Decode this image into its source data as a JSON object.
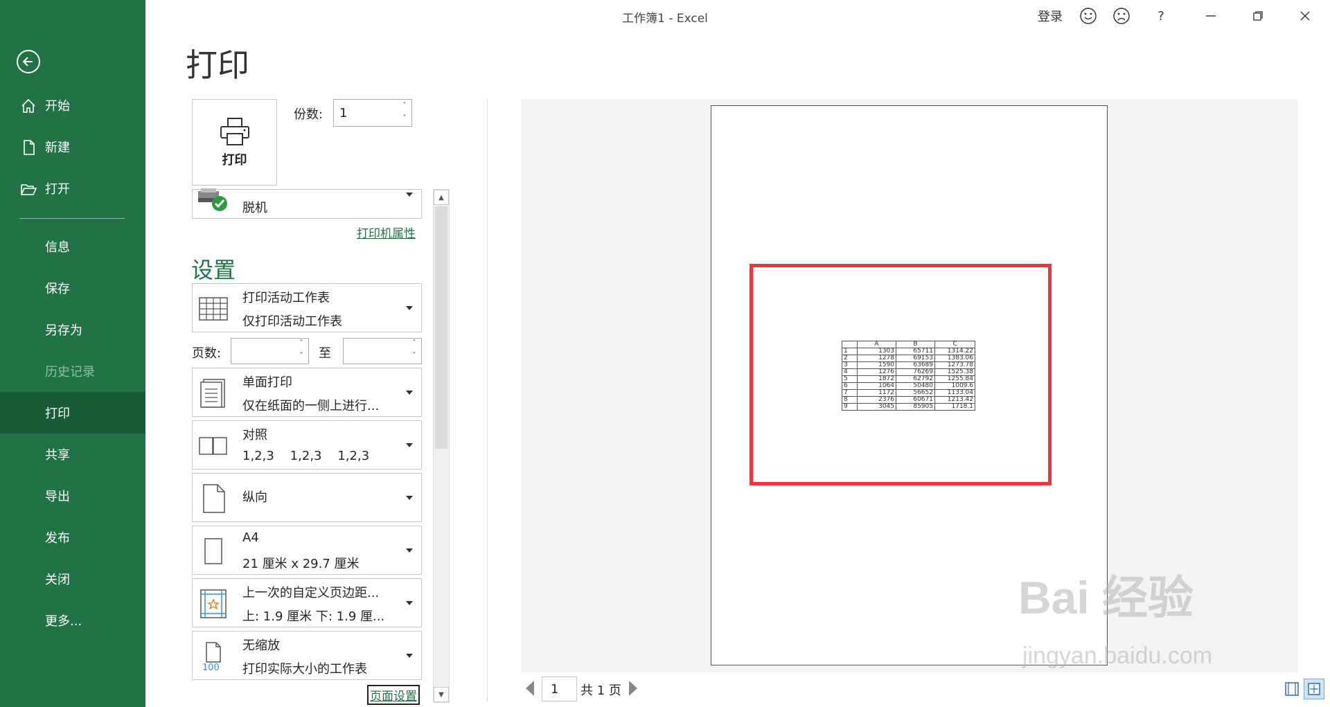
{
  "window": {
    "title": "工作簿1  -  Excel",
    "signin": "登录",
    "help": "?"
  },
  "sidebar": {
    "items": [
      {
        "label": "开始"
      },
      {
        "label": "新建"
      },
      {
        "label": "打开"
      },
      {
        "label": "信息"
      },
      {
        "label": "保存"
      },
      {
        "label": "另存为"
      },
      {
        "label": "历史记录"
      },
      {
        "label": "打印"
      },
      {
        "label": "共享"
      },
      {
        "label": "导出"
      },
      {
        "label": "发布"
      },
      {
        "label": "关闭"
      },
      {
        "label": "更多..."
      }
    ],
    "active": "打印"
  },
  "print": {
    "title": "打印",
    "print_button": "打印",
    "copies_label": "份数:",
    "copies_value": "1",
    "printer_name": "脱机",
    "printer_properties": "打印机属性",
    "settings_heading": "设置",
    "pages_label": "页数:",
    "pages_to": "至",
    "options": [
      {
        "line1": "打印活动工作表",
        "line2": "仅打印活动工作表"
      },
      {
        "line1": "单面打印",
        "line2": "仅在纸面的一侧上进行..."
      },
      {
        "line1": "对照",
        "line2": "1,2,3    1,2,3    1,2,3"
      },
      {
        "line1": "纵向"
      },
      {
        "line1": "A4",
        "line2": "21 厘米 x 29.7 厘米"
      },
      {
        "line1": "上一次的自定义页边距...",
        "line2": "上: 1.9 厘米 下: 1.9 厘..."
      },
      {
        "line1": "无缩放",
        "line2": "打印实际大小的工作表"
      }
    ],
    "scale_icon_text": "100",
    "page_setup": "页面设置"
  },
  "preview": {
    "current_page": "1",
    "total_pages": "共 1 页",
    "table": {
      "headers": [
        "A",
        "B",
        "C"
      ],
      "rows": [
        [
          "1",
          "1303",
          "65711",
          "1314.22"
        ],
        [
          "2",
          "1278",
          "69153",
          "1383.06"
        ],
        [
          "3",
          "1590",
          "63689",
          "1273.78"
        ],
        [
          "4",
          "1276",
          "76269",
          "1525.38"
        ],
        [
          "5",
          "1872",
          "62792",
          "1255.84"
        ],
        [
          "6",
          "1064",
          "50480",
          "1009.6"
        ],
        [
          "7",
          "1172",
          "56652",
          "1133.04"
        ],
        [
          "8",
          "2376",
          "60671",
          "1213.42"
        ],
        [
          "9",
          "3045",
          "85905",
          "1718.1"
        ]
      ]
    }
  },
  "watermark": {
    "brand": "Bai 经验",
    "url": "jingyan.baidu.com"
  },
  "colors": {
    "accent": "#217346",
    "sidebar_active": "#185c37",
    "highlight": "#e8383d"
  }
}
